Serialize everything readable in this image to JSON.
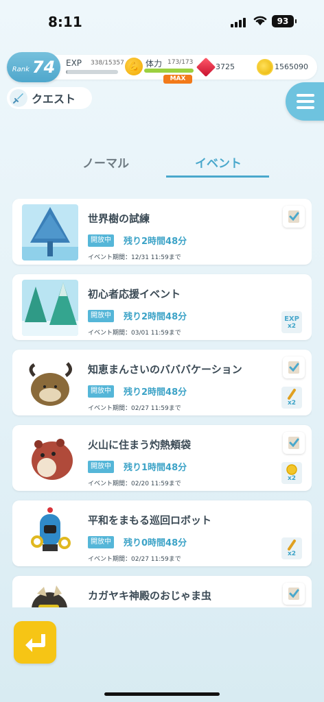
{
  "status": {
    "time": "8:11",
    "battery": "93"
  },
  "hud": {
    "rank_label": "Rank",
    "rank": "74",
    "exp_label": "EXP",
    "exp_value": "338/15357",
    "exp_progress": 0.02,
    "stamina_label": "体力",
    "stamina_value": "173/173",
    "stamina_progress": 1.0,
    "stamina_badge": "MAX",
    "gems": "3725",
    "coins": "1565090"
  },
  "quest_chip": {
    "label": "クエスト"
  },
  "tabs": [
    {
      "label": "ノーマル",
      "active": false
    },
    {
      "label": "イベント",
      "active": true
    }
  ],
  "events": [
    {
      "title": "世界樹の試練",
      "status": "開放中",
      "remaining": "残り2時間48分",
      "period": "イベント期間：12/31 11:59まで",
      "thumb": "blue-tree",
      "check": true,
      "bonus": ""
    },
    {
      "title": "初心者応援イベント",
      "status": "開放中",
      "remaining": "残り2時間48分",
      "period": "イベント期間：03/01 11:59まで",
      "thumb": "snowy-forest",
      "check": false,
      "bonus": "EXP",
      "bonus_mult": "x2"
    },
    {
      "title": "知恵まんさいのバババケーション",
      "status": "開放中",
      "remaining": "残り2時間48分",
      "period": "イベント期間：02/27 11:59まで",
      "thumb": "goat-monster",
      "check": true,
      "bonus": "scroll",
      "bonus_mult": "x2"
    },
    {
      "title": "火山に住まう灼熱頬袋",
      "status": "開放中",
      "remaining": "残り1時間48分",
      "period": "イベント期間：02/20 11:59まで",
      "thumb": "red-hamster",
      "check": true,
      "bonus": "coin",
      "bonus_mult": "x2"
    },
    {
      "title": "平和をまもる巡回ロボット",
      "status": "開放中",
      "remaining": "残り0時間48分",
      "period": "イベント期間：02/27 11:59まで",
      "thumb": "blue-robot",
      "check": false,
      "bonus": "scroll",
      "bonus_mult": "x2"
    },
    {
      "title": "カガヤキ神殿のおじゃま虫",
      "status": "",
      "remaining": "",
      "period": "",
      "thumb": "dark-creature",
      "check": true,
      "bonus": ""
    }
  ],
  "colors": {
    "accent": "#4aa8cc",
    "back_button": "#f6c515",
    "badge": "#f27a1a"
  },
  "icons": {
    "back": "return-arrow-icon",
    "menu": "hamburger-icon",
    "quest": "sword-icon"
  }
}
